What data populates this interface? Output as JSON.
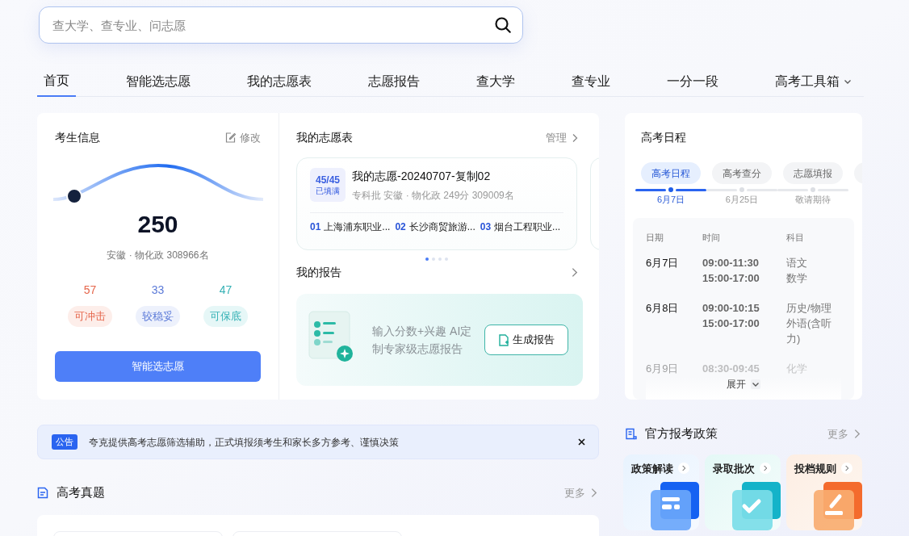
{
  "search": {
    "placeholder": "查大学、查专业、问志愿"
  },
  "nav": [
    {
      "label": "首页",
      "selected": true,
      "dropdown": false
    },
    {
      "label": "智能选志愿",
      "selected": false,
      "dropdown": false
    },
    {
      "label": "我的志愿表",
      "selected": false,
      "dropdown": false
    },
    {
      "label": "志愿报告",
      "selected": false,
      "dropdown": false
    },
    {
      "label": "查大学",
      "selected": false,
      "dropdown": false
    },
    {
      "label": "查专业",
      "selected": false,
      "dropdown": false
    },
    {
      "label": "一分一段",
      "selected": false,
      "dropdown": false
    },
    {
      "label": "高考工具箱",
      "selected": false,
      "dropdown": true
    }
  ],
  "student": {
    "title": "考生信息",
    "edit": "修改",
    "score": "250",
    "detail": "安徽 · 物化政 308966名",
    "stats": [
      {
        "count": "57",
        "label": "可冲击",
        "kind": "reach"
      },
      {
        "count": "33",
        "label": "较稳妥",
        "kind": "match"
      },
      {
        "count": "47",
        "label": "可保底",
        "kind": "safe"
      }
    ],
    "button": "智能选志愿"
  },
  "wishlist": {
    "title": "我的志愿表",
    "link": "管理",
    "card": {
      "count": "45/45",
      "status": "已填满",
      "name": "我的志愿-20240707-复制02",
      "detail": "专科批 安徽 · 物化政 249分 309009名",
      "picks": [
        {
          "index": "01",
          "school": "上海浦东职业..."
        },
        {
          "index": "02",
          "school": "长沙商贸旅游..."
        },
        {
          "index": "03",
          "school": "烟台工程职业..."
        }
      ]
    },
    "pages": [
      {
        "selected": true
      },
      {
        "selected": false
      },
      {
        "selected": false
      },
      {
        "selected": false
      }
    ]
  },
  "report": {
    "title": "我的报告",
    "description": "输入分数+兴趣 AI定制专家级志愿报告",
    "button": "生成报告"
  },
  "notice": {
    "badge": "公告",
    "text": "夸克提供高考志愿筛选辅助，正式填报须考生和家长多方参考、谨慎决策"
  },
  "exam_papers": {
    "title": "高考真题",
    "more": "更多"
  },
  "schedule": {
    "title": "高考日程",
    "tabs": [
      {
        "label": "高考日程",
        "date": "6月7日",
        "selected": true
      },
      {
        "label": "高考查分",
        "date": "6月25日",
        "selected": false
      },
      {
        "label": "志愿填报",
        "date": "敬请期待",
        "selected": false
      }
    ],
    "columns": [
      "日期",
      "时间",
      "科目"
    ],
    "rows": [
      {
        "date": "6月7日",
        "times": [
          "09:00-11:30",
          "15:00-17:00"
        ],
        "subjects": [
          "语文",
          "数学"
        ],
        "faded": false
      },
      {
        "date": "6月8日",
        "times": [
          "09:00-10:15",
          "15:00-17:00"
        ],
        "subjects": [
          "历史/物理",
          "外语(含听力)"
        ],
        "faded": false
      },
      {
        "date": "6月9日",
        "times": [
          "08:30-09:45"
        ],
        "subjects": [
          "化学"
        ],
        "faded": true
      }
    ],
    "expand": "展开"
  },
  "policy": {
    "title": "官方报考政策",
    "more": "更多",
    "tiles": [
      {
        "label": "政策解读",
        "kind": "doc"
      },
      {
        "label": "录取批次",
        "kind": "check"
      },
      {
        "label": "投档规则",
        "kind": "pen"
      }
    ]
  }
}
